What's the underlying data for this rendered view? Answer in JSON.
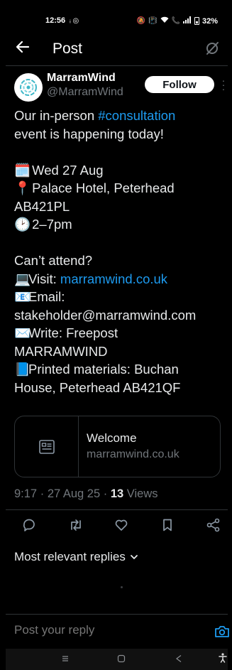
{
  "status_bar": {
    "time": "12:56",
    "left_icons": "ᵢ ◎",
    "battery": "32%"
  },
  "header": {
    "title": "Post"
  },
  "author": {
    "name": "MarramWind",
    "handle": "@MarramWind",
    "follow_label": "Follow"
  },
  "post": {
    "line1_text": "Our in-person ",
    "line1_hashtag": "#consultation",
    "line2": "event is happening today!",
    "date_emoji": "🗓️",
    "date": "Wed 27 Aug",
    "place_emoji": "📍",
    "place_line1": "Palace Hotel, Peterhead",
    "place_line2": "AB421PL",
    "time_emoji": "🕑",
    "time": "2–7pm",
    "cant_attend": "Can’t attend?",
    "visit_emoji": "💻",
    "visit_label": "Visit: ",
    "visit_link": "marramwind.co.uk",
    "email_emoji": "📧",
    "email_label": "Email:",
    "email_address": "stakeholder@marramwind.com",
    "write_emoji": "✉️",
    "write_line1": "Write: Freepost",
    "write_line2": "MARRAMWIND",
    "printed_emoji": "📘",
    "printed_line1": "Printed materials: Buchan",
    "printed_line2": "House, Peterhead AB421QF"
  },
  "card": {
    "title": "Welcome",
    "domain": "marramwind.co.uk"
  },
  "meta": {
    "time": "9:17",
    "date": "27 Aug 25",
    "views_count": "13",
    "views_label": "Views",
    "separator": "·"
  },
  "replies": {
    "header": "Most relevant replies",
    "input_placeholder": "Post your reply"
  },
  "colors": {
    "background": "#000000",
    "link": "#1d9bf0",
    "muted": "#71767b",
    "divider": "#2f3336"
  }
}
